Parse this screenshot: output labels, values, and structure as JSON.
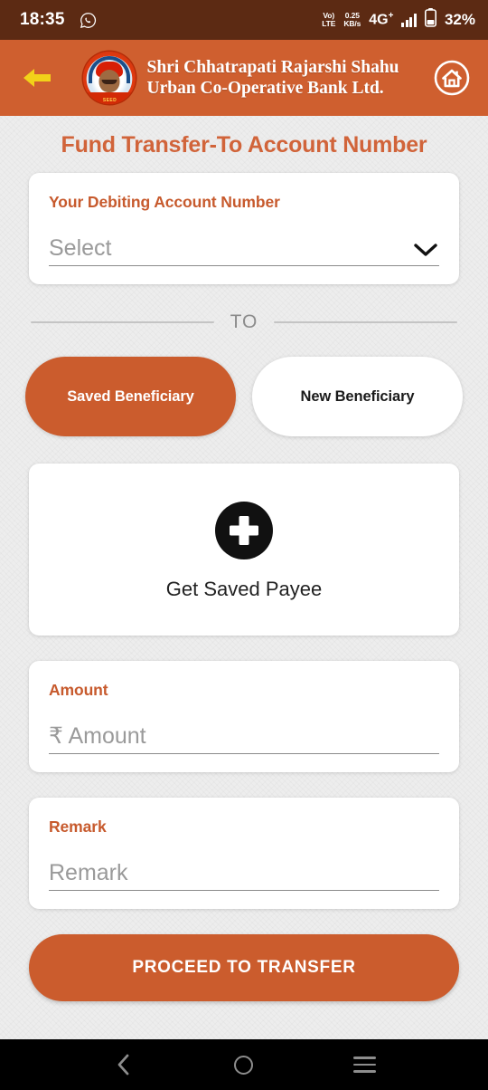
{
  "status_bar": {
    "time": "18:35",
    "whatsapp_icon": "whatsapp-icon",
    "volte": "VoLTE",
    "volte_line1": "Vo)",
    "volte_line2": "LTE",
    "data_rate_value": "0.25",
    "data_rate_unit": "KB/s",
    "network": "4G",
    "network_sup": "+",
    "signal": "signal-bars-icon",
    "battery_percent": "32%"
  },
  "header": {
    "back_icon": "back-arrow-icon",
    "bank_name_line1": "Shri Chhatrapati Rajarshi Shahu",
    "bank_name_line2": "Urban Co-Operative Bank Ltd.",
    "logo_caption": "SEED",
    "home_icon": "home-icon",
    "bg_color": "#cf5f2f",
    "back_arrow_color": "#f2d219"
  },
  "page": {
    "title": "Fund Transfer-To Account Number",
    "title_color": "#d1643a",
    "accent_color": "#cb5c2d",
    "background_color": "#ededed"
  },
  "debit_account": {
    "label": "Your Debiting Account Number",
    "select_value": "Select",
    "chevron_icon": "chevron-down-icon"
  },
  "divider": {
    "label": "TO"
  },
  "beneficiary_tabs": [
    {
      "label": "Saved Beneficiary",
      "selected": true
    },
    {
      "label": "New Beneficiary",
      "selected": false
    }
  ],
  "payee": {
    "add_icon": "plus-circle-icon",
    "label": "Get Saved Payee"
  },
  "amount": {
    "label": "Amount",
    "placeholder": "₹ Amount",
    "value": ""
  },
  "remark": {
    "label": "Remark",
    "placeholder": "Remark",
    "value": ""
  },
  "proceed_button": {
    "label": "PROCEED TO TRANSFER"
  },
  "nav_bar": {
    "back": "nav-back-icon",
    "home": "nav-home-icon",
    "recents": "nav-recents-icon"
  }
}
